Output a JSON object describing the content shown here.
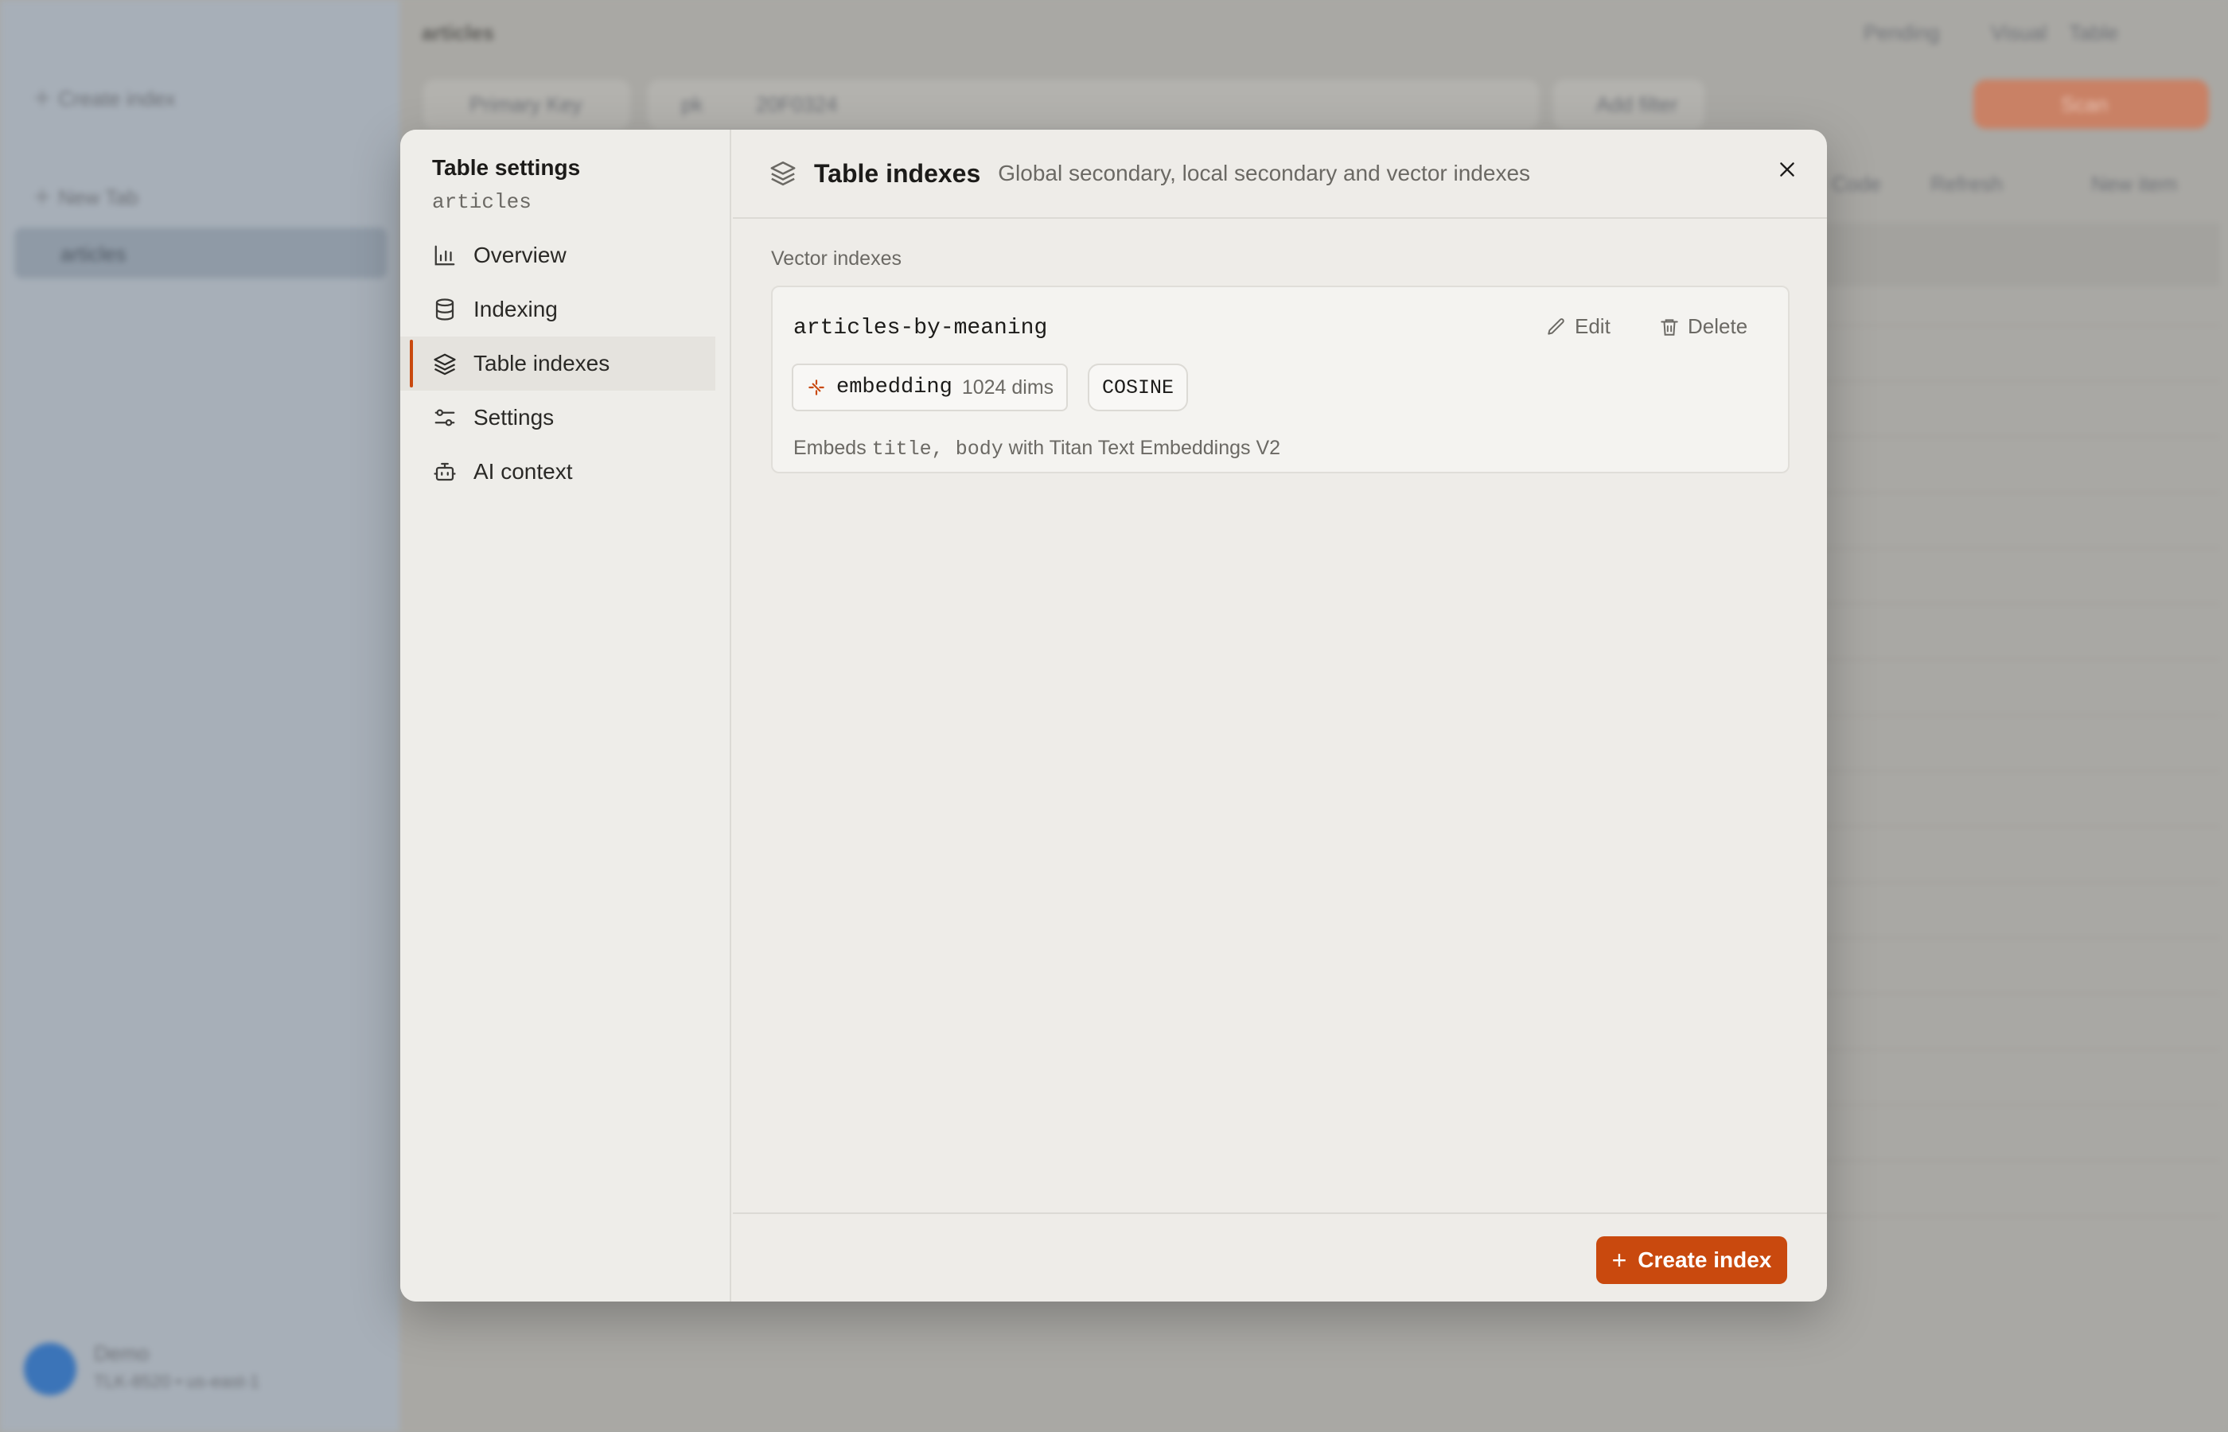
{
  "background": {
    "sidebar": {
      "create_index_label": "Create index",
      "new_tab_label": "New Tab",
      "selected_table": "articles",
      "user_name": "Demo",
      "user_sub": "TLK-8520 • us-east-1"
    },
    "topbar": {
      "table_name": "articles",
      "pending_label": "Pending",
      "visual_label": "Visual",
      "table_label": "Table"
    },
    "toolbar": {
      "index_select": "Primary Key",
      "operator": "pk",
      "value": "20F0324",
      "add_filter": "Add filter",
      "run_label": "Scan",
      "code_label": "Code",
      "refresh_label": "Refresh",
      "new_item_label": "New item"
    }
  },
  "modal": {
    "sidebar": {
      "title": "Table settings",
      "table_name": "articles",
      "nav": [
        {
          "label": "Overview",
          "icon": "bar-chart-icon"
        },
        {
          "label": "Indexing",
          "icon": "database-icon"
        },
        {
          "label": "Table indexes",
          "icon": "layers-icon",
          "active": true
        },
        {
          "label": "Settings",
          "icon": "sliders-icon"
        },
        {
          "label": "AI context",
          "icon": "bot-icon"
        }
      ]
    },
    "header": {
      "title": "Table indexes",
      "subtitle": "Global secondary, local secondary and vector indexes"
    },
    "section_label": "Vector indexes",
    "vector_index": {
      "name": "articles-by-meaning",
      "edit_label": "Edit",
      "delete_label": "Delete",
      "field": "embedding",
      "dims": "1024 dims",
      "metric": "COSINE",
      "desc_prefix": "Embeds",
      "desc_fields": "title, body",
      "desc_suffix": "with Titan Text Embeddings V2"
    },
    "footer": {
      "create_label": "Create index"
    }
  },
  "colors": {
    "accent": "#c9490e",
    "modal_bg": "#eeece8",
    "text": "#1c1b19",
    "muted": "#6b6964"
  }
}
